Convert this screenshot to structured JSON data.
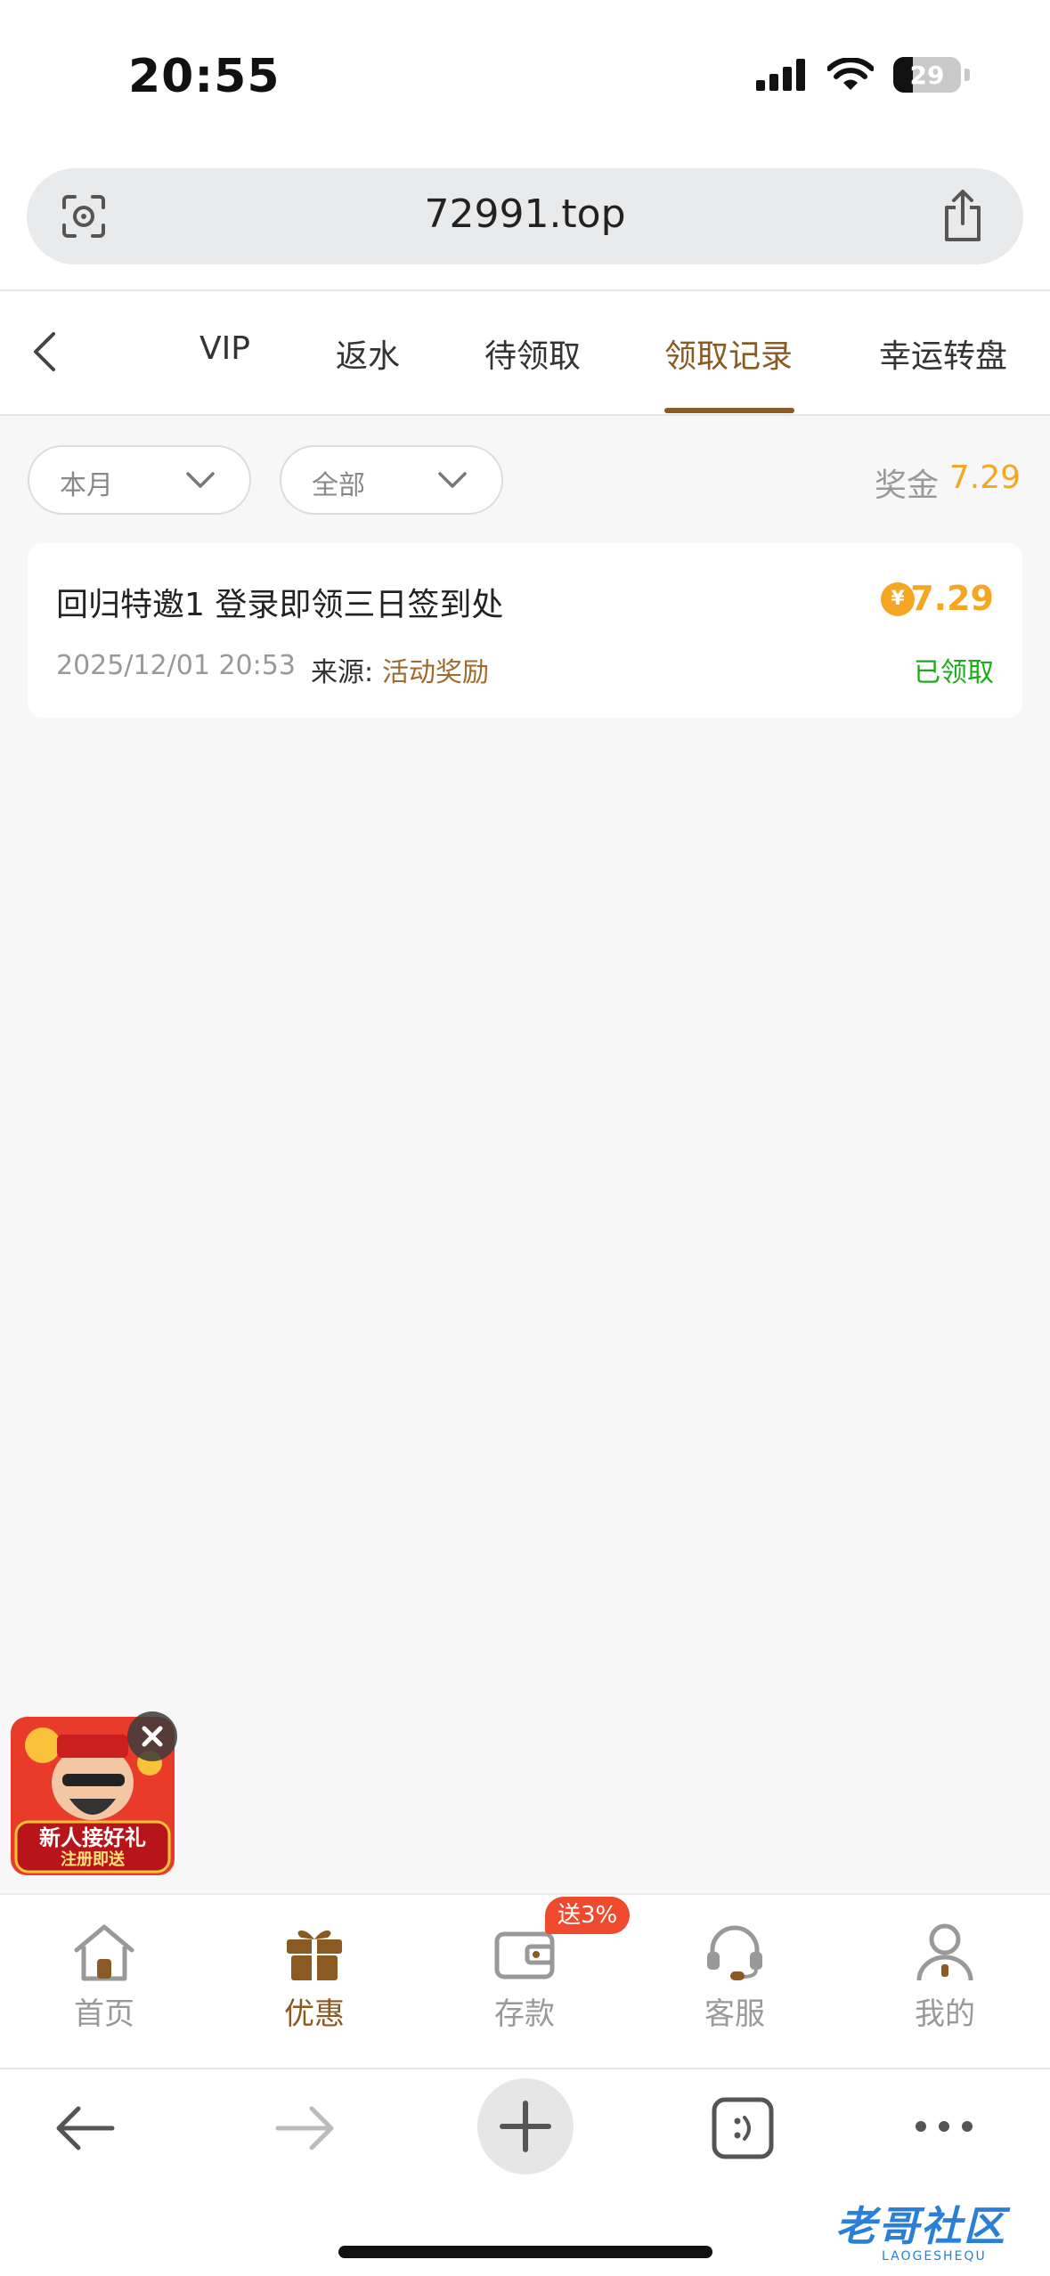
{
  "status_bar": {
    "time": "20:55",
    "battery": "29"
  },
  "browser": {
    "url": "72991.top"
  },
  "tabs": [
    {
      "label": "VIP"
    },
    {
      "label": "返水"
    },
    {
      "label": "待领取"
    },
    {
      "label": "领取记录"
    },
    {
      "label": "幸运转盘"
    }
  ],
  "filters": {
    "period": "本月",
    "category": "全部",
    "bonus_label": "奖金",
    "bonus_total": "7.29"
  },
  "records": [
    {
      "title": "回归特邀1 登录即领三日签到处",
      "amount": "7.29",
      "coin_symbol": "¥",
      "date": "2025/12/01 20:53",
      "source_label": "来源:",
      "source_value": "活动奖励",
      "status": "已领取"
    }
  ],
  "promo": {
    "line1": "新人接好礼",
    "line2": "注册即送"
  },
  "bottom_nav": [
    {
      "label": "首页",
      "icon": "home-icon"
    },
    {
      "label": "优惠",
      "icon": "gift-icon"
    },
    {
      "label": "存款",
      "icon": "wallet-icon",
      "badge": "送3%"
    },
    {
      "label": "客服",
      "icon": "headset-icon"
    },
    {
      "label": "我的",
      "icon": "user-icon"
    }
  ],
  "watermark": {
    "text": "老哥社区",
    "sub": "LAOGESHEQU"
  },
  "colors": {
    "accent": "#8a5a22",
    "gold": "#f5a623",
    "success": "#1aad19",
    "badge": "#f04a2e"
  }
}
